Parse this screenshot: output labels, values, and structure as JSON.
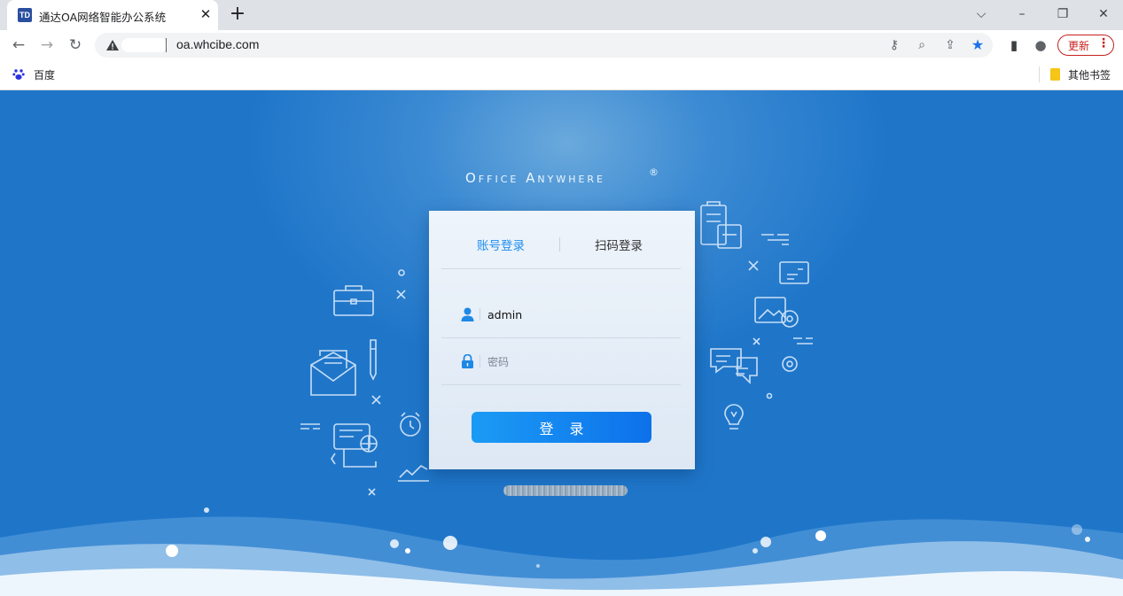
{
  "browser": {
    "tab_title": "通达OA网络智能办公系统",
    "tab_favicon": "TD",
    "tab_close": "✕",
    "new_tab": "+",
    "url": "oa.whcibe.com",
    "update_label": "更新",
    "update_menu": "⋮",
    "bookmarks": {
      "left": "百度",
      "right": "其他书签"
    },
    "icons": {
      "back": "←",
      "forward": "→",
      "reload": "↻",
      "key": "⚷",
      "zoom": "⌕",
      "share": "⇪",
      "star": "★",
      "sidepanel": "▮",
      "profile": "●",
      "dropdown": "⌵",
      "minimize": "–",
      "restore": "❐",
      "close": "✕"
    }
  },
  "page": {
    "brand": "Office Anywhere",
    "brand_mark": "®",
    "tabs": {
      "account": "账号登录",
      "qrcode": "扫码登录"
    },
    "username": {
      "value": "admin"
    },
    "password": {
      "placeholder": "密码",
      "value": ""
    },
    "login_label": "登录"
  },
  "colors": {
    "background": "#1f76c9",
    "accent": "#0d71ea",
    "tab_active": "#1f8ef0",
    "tab_inactive": "#333333",
    "update_red": "#c5221f"
  }
}
